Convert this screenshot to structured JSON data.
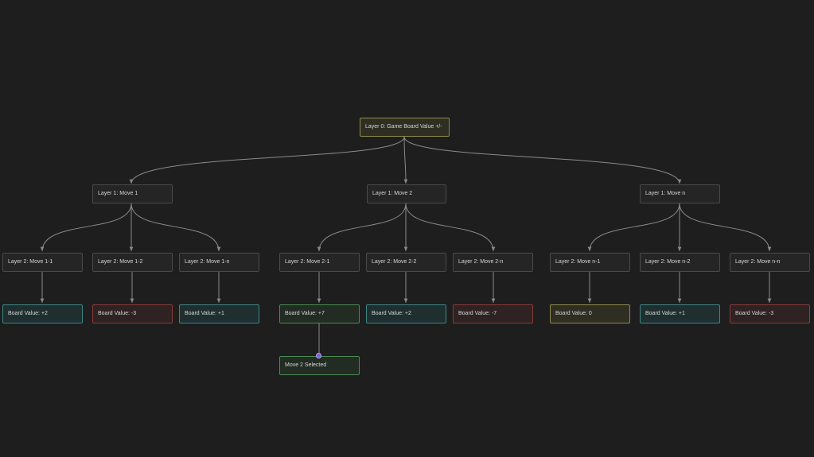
{
  "colors": {
    "background": "#1e1e1e",
    "edge": "#8a8a8a",
    "default_border": "#4a4a4a",
    "yellow_border": "#8f8a4b",
    "teal_border": "#3f8584",
    "red_border": "#8b3a3a",
    "green_border": "#4b8a52",
    "selected_handle": "#7b5ce0"
  },
  "tree": {
    "root": "Layer 0: Game Board Value +/-",
    "layer1": [
      "Layer 1: Move 1",
      "Layer 1: Move 2",
      "Layer 1: Move n"
    ],
    "layer2": [
      "Layer 2: Move 1-1",
      "Layer 2: Move 1-2",
      "Layer 2: Move 1-n",
      "Layer 2: Move 2-1",
      "Layer 2: Move 2-2",
      "Layer 2: Move 2-n",
      "Layer 2: Move n-1",
      "Layer 2: Move n-2",
      "Layer 2: Move n-n"
    ],
    "values": [
      "Board Value: +2",
      "Board Value: -3",
      "Board Value: +1",
      "Board Value: +7",
      "Board Value: +2",
      "Board Value: -7",
      "Board Value: 0",
      "Board Value: +1",
      "Board Value: -3"
    ],
    "selected": "Move 2 Selected"
  }
}
